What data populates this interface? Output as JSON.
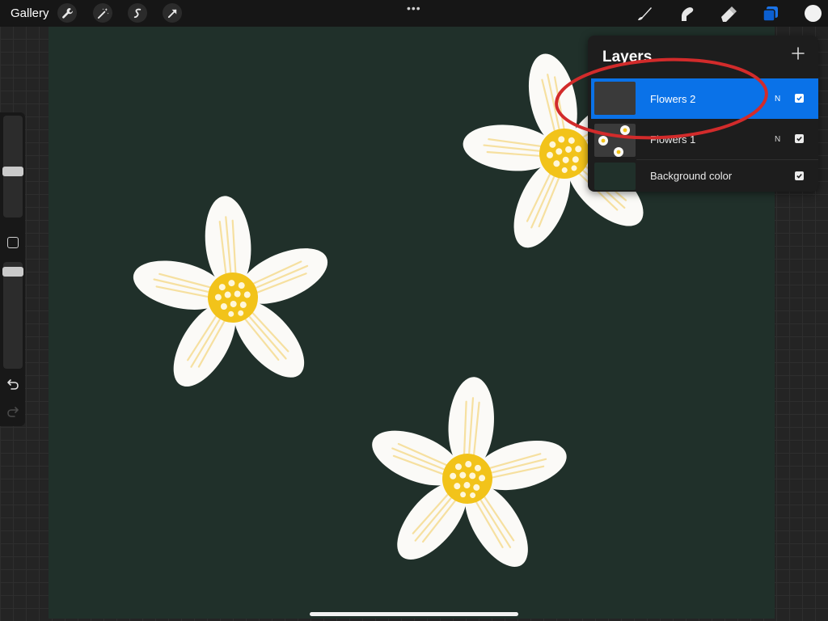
{
  "toolbar": {
    "gallery_label": "Gallery",
    "left_tools": [
      "wrench-icon",
      "magic-wand-icon",
      "selection-icon",
      "transform-icon"
    ],
    "more_label": "•••",
    "right_tools": [
      "brush-icon",
      "smudge-icon",
      "eraser-icon",
      "layers-icon"
    ],
    "active_tool": "layers",
    "current_color": "#f2f2f2"
  },
  "sidebar": {
    "brush_size_level": 0.45,
    "opacity_level": 0.95,
    "undo_icon": "undo-icon",
    "redo_icon": "redo-icon"
  },
  "layers_panel": {
    "title": "Layers",
    "add_icon": "plus-icon",
    "layers": [
      {
        "name": "Flowers 2",
        "blend": "N",
        "visible": true,
        "selected": true
      },
      {
        "name": "Flowers 1",
        "blend": "N",
        "visible": true,
        "selected": false
      },
      {
        "name": "Background color",
        "blend": "",
        "visible": true,
        "selected": false
      }
    ]
  },
  "colors": {
    "accent": "#0a72e8",
    "canvas_background": "#20302a",
    "petal": "#fbfaf7",
    "flower_center": "#f2c31a",
    "annotation_ellipse": "#d22b2b"
  }
}
